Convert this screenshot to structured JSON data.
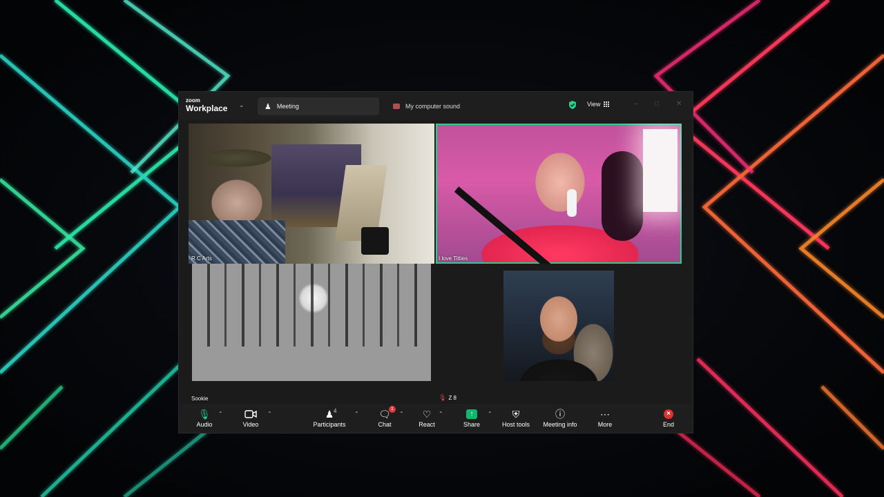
{
  "app": {
    "brand_small": "zoom",
    "brand_big": "Workplace",
    "tabs": [
      {
        "label": "Meeting",
        "icon": "participants-icon"
      },
      {
        "label": "My computer sound",
        "icon": "screen-share-icon"
      }
    ],
    "view_label": "View",
    "accent_green": "#23d18b",
    "share_green": "#0fb86c",
    "end_red": "#e02f2f"
  },
  "participants": [
    {
      "name": "R.C Arts",
      "muted": false,
      "active_speaker": false
    },
    {
      "name": "I love Titties",
      "muted": false,
      "active_speaker": true
    },
    {
      "name": "Sookie",
      "muted": false,
      "active_speaker": false
    },
    {
      "name": "Z 8",
      "muted": true,
      "active_speaker": false
    }
  ],
  "toolbar": {
    "audio": "Audio",
    "video": "Video",
    "participants": "Participants",
    "participants_count": "4",
    "chat": "Chat",
    "chat_badge": "1",
    "react": "React",
    "share": "Share",
    "host_tools": "Host tools",
    "meeting_info": "Meeting info",
    "more": "More",
    "end": "End"
  }
}
